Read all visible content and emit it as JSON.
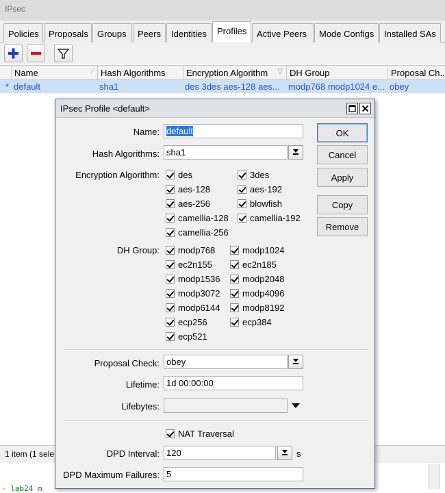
{
  "window": {
    "title": "IPsec"
  },
  "tabs": [
    "Policies",
    "Proposals",
    "Groups",
    "Peers",
    "Identities",
    "Profiles",
    "Active Peers",
    "Mode Configs",
    "Installed SAs"
  ],
  "table": {
    "columns": [
      "Name",
      "Hash Algorithms",
      "Encryption Algorithm",
      "DH Group",
      "Proposal Ch..."
    ],
    "row": {
      "marker": "*",
      "name": "default",
      "hash": "sha1",
      "encryption": "des 3des aes-128 aes...",
      "dh_group": "modp768 modp1024 e...",
      "proposal_check": "obey"
    }
  },
  "status": {
    "text": "1 item (1 sele"
  },
  "bottom_snippet": "- lab24 m",
  "dialog": {
    "title": "IPsec Profile <default>",
    "labels": {
      "name": "Name:",
      "hash": "Hash Algorithms:",
      "encryption": "Encryption Algorithm:",
      "dh_group": "DH Group:",
      "proposal_check": "Proposal Check:",
      "lifetime": "Lifetime:",
      "lifebytes": "Lifebytes:",
      "dpd_interval": "DPD Interval:",
      "dpd_max_failures": "DPD Maximum Failures:"
    },
    "values": {
      "name": "default",
      "hash": "sha1",
      "proposal_check": "obey",
      "lifetime": "1d 00:00:00",
      "lifebytes": "",
      "dpd_interval": "120",
      "dpd_interval_unit": "s",
      "dpd_max_failures": "5"
    },
    "encryption_algorithms": [
      "des",
      "3des",
      "aes-128",
      "aes-192",
      "aes-256",
      "blowfish",
      "camellia-128",
      "camellia-192",
      "camellia-256"
    ],
    "dh_groups": [
      "modp768",
      "modp1024",
      "ec2n155",
      "ec2n185",
      "modp1536",
      "modp2048",
      "modp3072",
      "modp4096",
      "modp6144",
      "modp8192",
      "ecp256",
      "ecp384",
      "ecp521"
    ],
    "nat_traversal": {
      "label": "NAT Traversal",
      "checked": true
    },
    "buttons": {
      "ok": "OK",
      "cancel": "Cancel",
      "apply": "Apply",
      "copy": "Copy",
      "remove": "Remove"
    }
  },
  "colors": {
    "selection": "#3277d8",
    "row_highlight": "#cfe0f5",
    "link_text": "#2856cc",
    "add_icon": "#1c3fa8",
    "remove_icon": "#c0202a"
  }
}
